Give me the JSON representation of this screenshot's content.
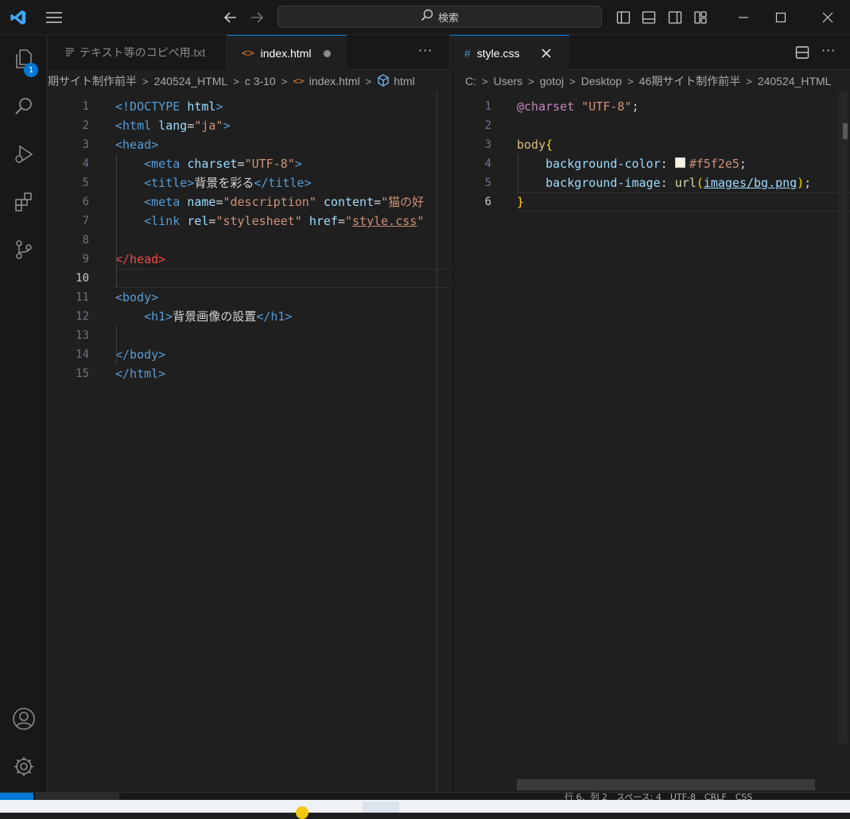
{
  "titlebar": {
    "search_label": "検索",
    "icons": [
      "vscode-logo-icon",
      "menu-icon",
      "back-arrow-icon",
      "forward-arrow-icon",
      "toggle-primary-sidebar-icon",
      "toggle-panel-icon",
      "toggle-secondary-sidebar-icon",
      "customize-layout-icon",
      "minimize-icon",
      "maximize-icon",
      "close-icon"
    ]
  },
  "activitybar": {
    "explorer_badge": "1",
    "items": [
      "explorer-icon",
      "search-icon",
      "run-debug-icon",
      "extensions-icon",
      "source-control-icon"
    ],
    "bottom": [
      "account-icon",
      "settings-gear-icon"
    ]
  },
  "left_editor": {
    "tabs": [
      {
        "label": "テキスト等のコピペ用.txt",
        "active": false
      },
      {
        "label": "index.html",
        "active": true,
        "modified": true
      }
    ],
    "breadcrumb": [
      "期サイト制作前半",
      "240524_HTML",
      "c 3-10",
      "index.html",
      "html"
    ],
    "lines": [
      {
        "n": "1",
        "tokens": [
          [
            "tag",
            "<!DOCTYPE "
          ],
          [
            "attr",
            "html"
          ],
          [
            "tag",
            ">"
          ]
        ]
      },
      {
        "n": "2",
        "tokens": [
          [
            "tag",
            "<html "
          ],
          [
            "attr",
            "lang"
          ],
          [
            "text",
            "="
          ],
          [
            "str",
            "\"ja\""
          ],
          [
            "tag",
            ">"
          ]
        ]
      },
      {
        "n": "3",
        "tokens": [
          [
            "tag",
            "<head>"
          ]
        ]
      },
      {
        "n": "4",
        "tokens": [
          [
            "text",
            "    "
          ],
          [
            "tag",
            "<meta "
          ],
          [
            "attr",
            "charset"
          ],
          [
            "text",
            "="
          ],
          [
            "str",
            "\"UTF-8\""
          ],
          [
            "tag",
            ">"
          ]
        ]
      },
      {
        "n": "5",
        "tokens": [
          [
            "text",
            "    "
          ],
          [
            "tag",
            "<title>"
          ],
          [
            "text",
            "背景を彩る"
          ],
          [
            "tag",
            "</title>"
          ]
        ]
      },
      {
        "n": "6",
        "tokens": [
          [
            "text",
            "    "
          ],
          [
            "tag",
            "<meta "
          ],
          [
            "attr",
            "name"
          ],
          [
            "text",
            "="
          ],
          [
            "str",
            "\"description\""
          ],
          [
            "text",
            " "
          ],
          [
            "attr",
            "content"
          ],
          [
            "text",
            "="
          ],
          [
            "str",
            "\"猫の好"
          ]
        ]
      },
      {
        "n": "7",
        "tokens": [
          [
            "text",
            "    "
          ],
          [
            "tag",
            "<link "
          ],
          [
            "attr",
            "rel"
          ],
          [
            "text",
            "="
          ],
          [
            "str",
            "\"stylesheet\""
          ],
          [
            "text",
            " "
          ],
          [
            "attr",
            "href"
          ],
          [
            "text",
            "="
          ],
          [
            "str",
            "\""
          ],
          [
            "strlink",
            "style.css"
          ],
          [
            "str",
            "\""
          ]
        ]
      },
      {
        "n": "8",
        "tokens": []
      },
      {
        "n": "9",
        "tokens": [
          [
            "red",
            "</head>"
          ]
        ]
      },
      {
        "n": "10",
        "tokens": [],
        "current": true
      },
      {
        "n": "11",
        "tokens": [
          [
            "tag",
            "<body>"
          ]
        ]
      },
      {
        "n": "12",
        "tokens": [
          [
            "text",
            "    "
          ],
          [
            "tag",
            "<h1>"
          ],
          [
            "text",
            "背景画像の設置"
          ],
          [
            "tag",
            "</h1>"
          ]
        ]
      },
      {
        "n": "13",
        "tokens": []
      },
      {
        "n": "14",
        "tokens": [
          [
            "tag",
            "</body>"
          ]
        ]
      },
      {
        "n": "15",
        "tokens": [
          [
            "tag",
            "</html>"
          ]
        ]
      }
    ]
  },
  "right_editor": {
    "tabs": [
      {
        "label": "style.css",
        "active": true,
        "icon_text": "#"
      }
    ],
    "breadcrumb": [
      "C:",
      "Users",
      "gotoj",
      "Desktop",
      "46期サイト制作前半",
      "240524_HTML"
    ],
    "lines": [
      {
        "n": "1",
        "tokens": [
          [
            "at",
            "@charset "
          ],
          [
            "str",
            "\"UTF-8\""
          ],
          [
            "punct",
            ";"
          ]
        ]
      },
      {
        "n": "2",
        "tokens": []
      },
      {
        "n": "3",
        "tokens": [
          [
            "sel",
            "body"
          ],
          [
            "brace",
            "{"
          ]
        ]
      },
      {
        "n": "4",
        "tokens": [
          [
            "text",
            "    "
          ],
          [
            "prop",
            "background-color"
          ],
          [
            "punct",
            ": "
          ],
          [
            "swatch",
            ""
          ],
          [
            "str",
            "#f5f2e5"
          ],
          [
            "punct",
            ";"
          ]
        ]
      },
      {
        "n": "5",
        "tokens": [
          [
            "text",
            "    "
          ],
          [
            "prop",
            "background-image"
          ],
          [
            "punct",
            ": "
          ],
          [
            "fn",
            "url"
          ],
          [
            "brace",
            "("
          ],
          [
            "linkstr",
            "images/bg.png"
          ],
          [
            "brace",
            ")"
          ],
          [
            "punct",
            ";"
          ]
        ]
      },
      {
        "n": "6",
        "tokens": [
          [
            "brace",
            "}"
          ]
        ],
        "current": true
      }
    ]
  },
  "statusbar": {
    "text": "行 6、列 2　スペース: 4　UTF-8　CRLF　CSS"
  },
  "colors": {
    "accent": "#0078d4",
    "background": "#1f1f1f",
    "sidebar": "#181818"
  }
}
